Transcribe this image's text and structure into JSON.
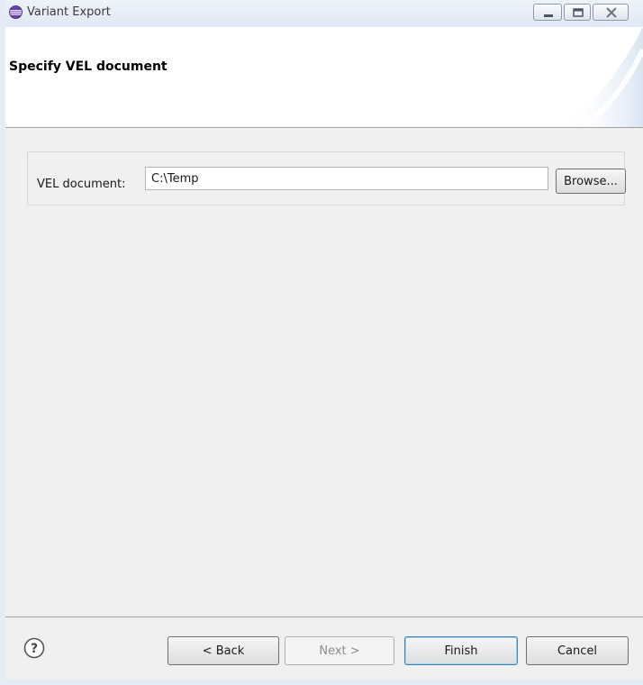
{
  "window": {
    "title": "Variant Export",
    "controls": {
      "minimize": "minimize",
      "maximize": "maximize",
      "close": "close"
    }
  },
  "header": {
    "title": "Specify VEL document"
  },
  "form": {
    "vel_label": "VEL document:",
    "vel_value": "C:\\Temp",
    "browse_label": "Browse..."
  },
  "footer": {
    "help_icon": "question-circle-icon",
    "back_label": "< Back",
    "next_label": "Next >",
    "finish_label": "Finish",
    "cancel_label": "Cancel"
  },
  "colors": {
    "titlebar": "#dfe8f4",
    "finish_border": "#3c7fb1",
    "app_icon": "#7a4fb8"
  }
}
